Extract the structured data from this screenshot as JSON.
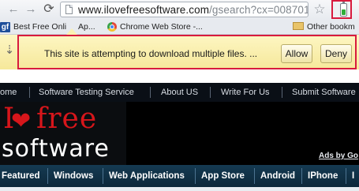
{
  "browser": {
    "back_icon": "back-arrow-icon",
    "forward_icon": "forward-arrow-icon",
    "reload_icon": "reload-icon",
    "url_host": "www.ilovefreesoftware.com",
    "url_path": "/gsearch?cx=0087015:",
    "star_icon": "star-icon",
    "extension_icon": "battery-icon"
  },
  "bookmarks": {
    "items": [
      {
        "label": "Best Free Onli",
        "suffix": "Ap..."
      },
      {
        "label": "Chrome Web Store -..."
      },
      {
        "label": "Other bookm"
      }
    ]
  },
  "infobar": {
    "message": "This site is attempting to download multiple files. ...",
    "allow_label": "Allow",
    "deny_label": "Deny"
  },
  "site": {
    "nav": [
      "ome",
      "Software Testing Service",
      "About US",
      "Write For Us",
      "Submit Software"
    ],
    "logo_free": "free",
    "logo_software": "software",
    "ads_label": "Ads by Go",
    "categories": [
      "Featured",
      "Windows",
      "Web Applications",
      "App Store",
      "Android",
      "IPhone",
      "I"
    ]
  },
  "colors": {
    "highlight": "#d81b3e",
    "infobar_bg": "#fdf6c3",
    "logo_red": "#d7161b",
    "category_bg": "#153a52"
  }
}
